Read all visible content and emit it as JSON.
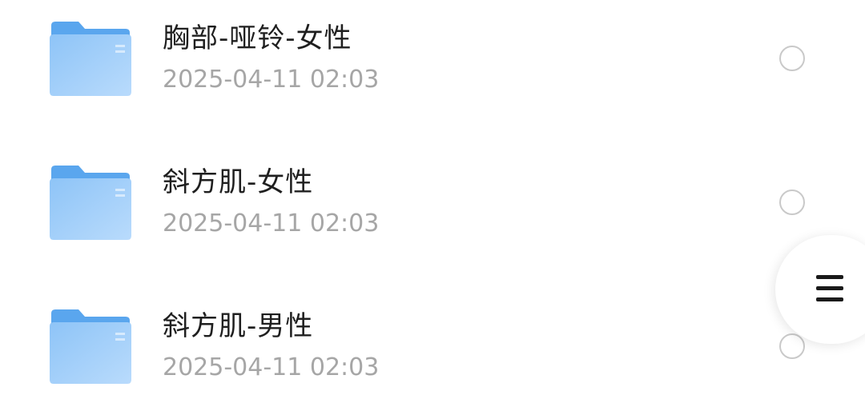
{
  "files": [
    {
      "name": "胸部-哑铃-女性",
      "date": "2025-04-11 02:03",
      "icon": "folder-icon",
      "selected": false
    },
    {
      "name": "斜方肌-女性",
      "date": "2025-04-11 02:03",
      "icon": "folder-icon",
      "selected": false
    },
    {
      "name": "斜方肌-男性",
      "date": "2025-04-11 02:03",
      "icon": "folder-icon",
      "selected": false
    }
  ],
  "floating_menu": {
    "icon": "menu-icon"
  },
  "colors": {
    "folder_back": "#5aa6ee",
    "folder_front": "#9ccdfa",
    "name_text": "#1f1f1f",
    "date_text": "#a6a6a6",
    "radio_border": "#c9c9c9"
  }
}
